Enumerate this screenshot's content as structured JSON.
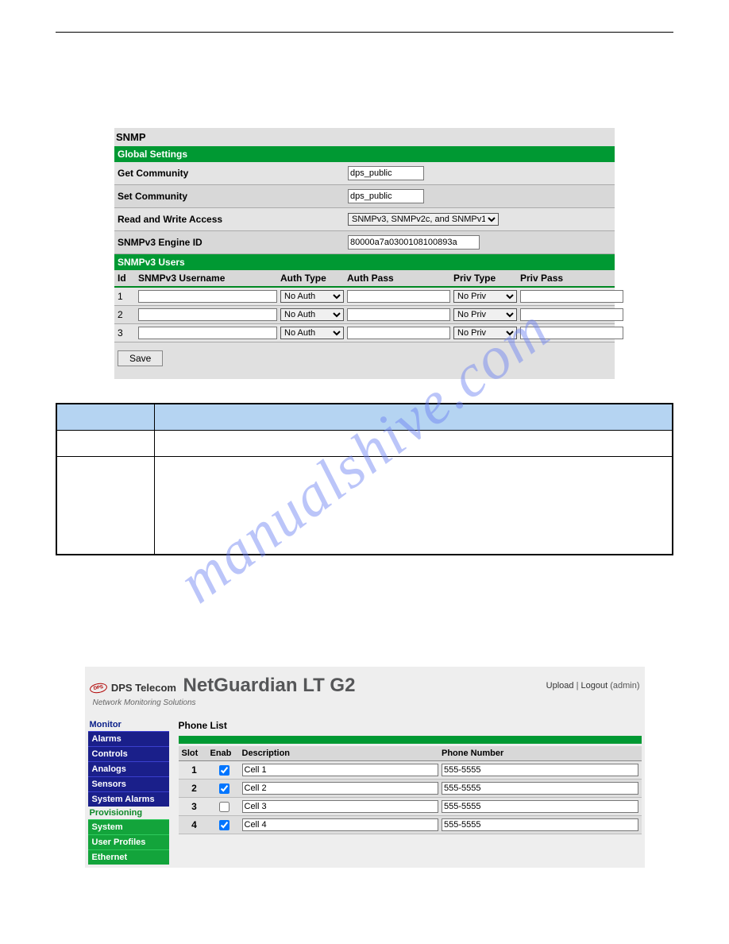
{
  "snmp": {
    "title": "SNMP",
    "global_settings": "Global Settings",
    "get_community_label": "Get Community",
    "get_community_value": "dps_public",
    "set_community_label": "Set Community",
    "set_community_value": "dps_public",
    "rw_access_label": "Read and Write Access",
    "rw_access_value": "SNMPv3, SNMPv2c, and SNMPv1",
    "engine_id_label": "SNMPv3 Engine ID",
    "engine_id_value": "80000a7a0300108100893a",
    "users_header": "SNMPv3 Users",
    "cols": {
      "id": "Id",
      "username": "SNMPv3 Username",
      "auth_type": "Auth Type",
      "auth_pass": "Auth Pass",
      "priv_type": "Priv Type",
      "priv_pass": "Priv Pass"
    },
    "rows": [
      {
        "id": "1",
        "auth_type": "No Auth",
        "priv_type": "No Priv"
      },
      {
        "id": "2",
        "auth_type": "No Auth",
        "priv_type": "No Priv"
      },
      {
        "id": "3",
        "auth_type": "No Auth",
        "priv_type": "No Priv"
      }
    ],
    "save_label": "Save"
  },
  "watermark": "manualshive.com",
  "ng": {
    "brand": "DPS Telecom",
    "tagline": "Network Monitoring Solutions",
    "title": "NetGuardian LT G2",
    "links": {
      "upload": "Upload",
      "logout": "Logout",
      "user": "(admin)"
    },
    "nav": {
      "monitor": "Monitor",
      "monitor_items": [
        "Alarms",
        "Controls",
        "Analogs",
        "Sensors",
        "System Alarms"
      ],
      "provisioning": "Provisioning",
      "prov_items": [
        "System",
        "User Profiles",
        "Ethernet"
      ]
    },
    "section_title": "Phone List",
    "cols": {
      "slot": "Slot",
      "enab": "Enab",
      "desc": "Description",
      "phone": "Phone Number"
    },
    "rows": [
      {
        "slot": "1",
        "enab": true,
        "desc": "Cell 1",
        "phone": "555-5555"
      },
      {
        "slot": "2",
        "enab": true,
        "desc": "Cell 2",
        "phone": "555-5555"
      },
      {
        "slot": "3",
        "enab": false,
        "desc": "Cell 3",
        "phone": "555-5555"
      },
      {
        "slot": "4",
        "enab": true,
        "desc": "Cell 4",
        "phone": "555-5555"
      }
    ]
  }
}
